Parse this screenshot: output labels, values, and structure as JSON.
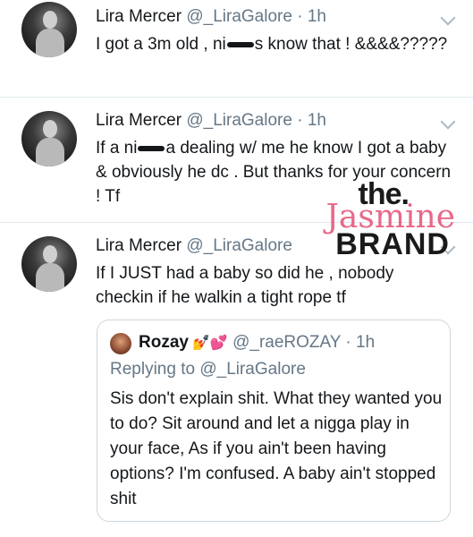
{
  "tweets": [
    {
      "name": "Lira Mercer",
      "handle": "@_LiraGalore",
      "time": "· 1h",
      "text_before": "I got a 3m old , ni",
      "text_after": "s know that ! &&&&?????"
    },
    {
      "name": "Lira Mercer",
      "handle": "@_LiraGalore",
      "time": "· 1h",
      "text_before": "If a ni",
      "text_after": "a dealing w/ me he know I got a baby & obviously he dc . But thanks for your concern ! Tf"
    },
    {
      "name": "Lira Mercer",
      "handle": "@_LiraGalore",
      "text": "If I JUST had a baby so did he , nobody checkin if he walkin a tight rope tf"
    }
  ],
  "quote": {
    "name": "Rozay",
    "emoji": "💅💕",
    "handle": "@_raeROZAY",
    "time": "· 1h",
    "reply_to": "Replying to @_LiraGalore",
    "text": "Sis don't explain shit. What they wanted you to do? Sit around and let a nigga play in your face, As if you ain't been having options? I'm confused. A baby ain't stopped shit"
  },
  "watermark": {
    "the": "the.",
    "jasmine": "Jasmine",
    "brand": "BRAND"
  }
}
